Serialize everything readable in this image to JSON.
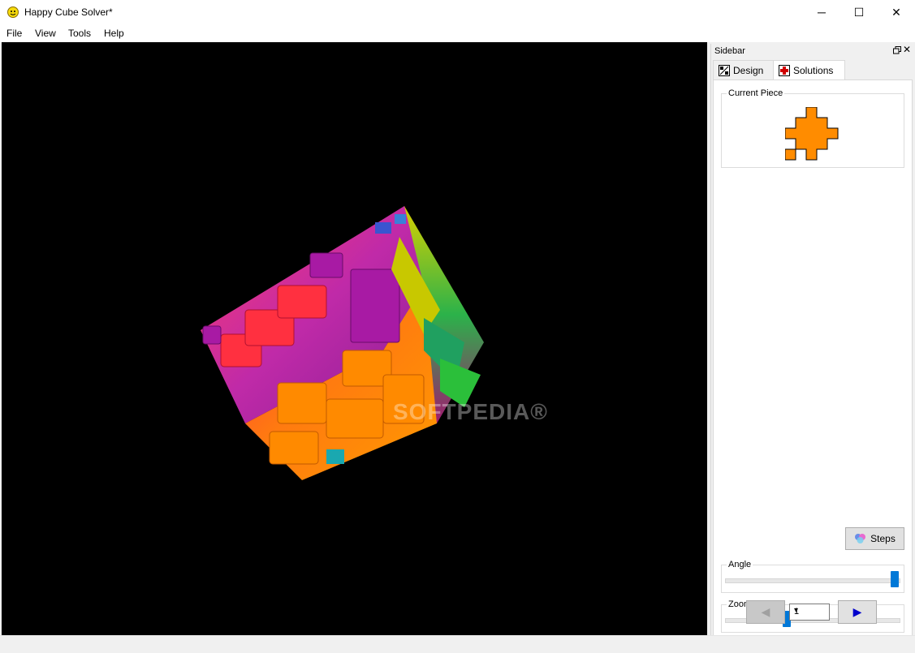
{
  "window": {
    "title": "Happy Cube Solver*",
    "minimize": "─",
    "maximize": "☐",
    "close": "✕"
  },
  "menu": [
    "File",
    "View",
    "Tools",
    "Help"
  ],
  "viewport": {
    "watermark": "SOFTPEDIA®"
  },
  "sidebar": {
    "title": "Sidebar",
    "close": "✕",
    "tabs": [
      {
        "label": "Design",
        "icon": "design-icon"
      },
      {
        "label": "Solutions",
        "icon": "solutions-icon"
      }
    ],
    "active_tab": "Solutions",
    "current_piece_label": "Current Piece",
    "piece_color": "#ff8c00",
    "steps_label": "Steps",
    "angle_label": "Angle",
    "angle_level": 1.0,
    "zoom_label": "Zoom",
    "zoom_level": 0.35,
    "prev_glyph": "◀",
    "next_glyph": "▶",
    "page_value": "1"
  },
  "colors": {
    "accent": "#0078d7",
    "viewport_bg": "#000000"
  }
}
